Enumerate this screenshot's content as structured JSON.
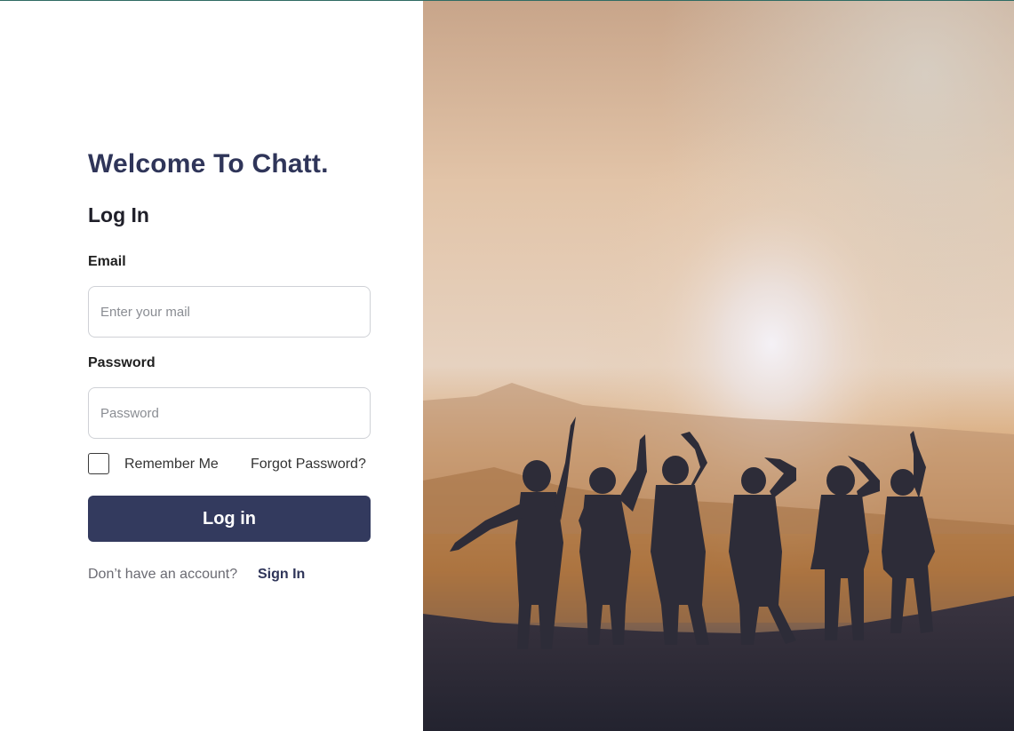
{
  "app": {
    "welcome_title": "Welcome To Chatt.",
    "form_title": "Log In"
  },
  "form": {
    "email_label": "Email",
    "email_placeholder": "Enter your mail",
    "password_label": "Password",
    "password_placeholder": "Password",
    "remember_label": "Remember Me",
    "remember_checked": false,
    "forgot_label": "Forgot Password?",
    "submit_label": "Log in"
  },
  "footer": {
    "prompt": "Don’t have an account?",
    "signup_label": "Sign In"
  },
  "hero": {
    "image": "sunset-silhouette-group-photo"
  },
  "colors": {
    "accent": "#333a5e",
    "title": "#2f3559"
  }
}
